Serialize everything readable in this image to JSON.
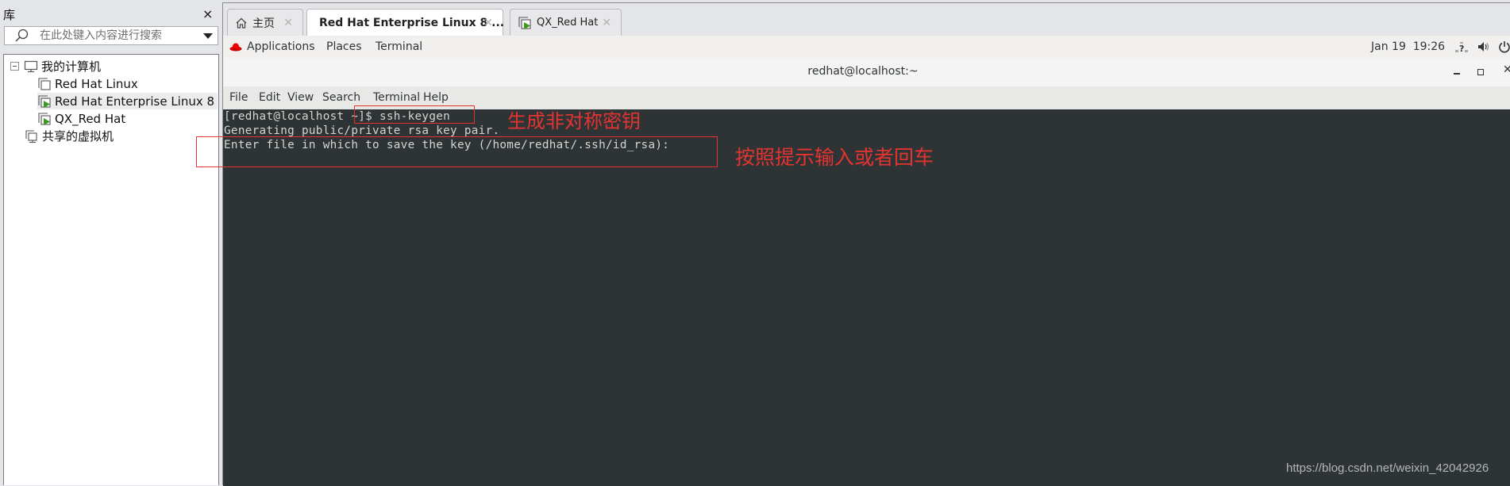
{
  "library": {
    "title": "库",
    "close_icon": "×",
    "search_placeholder": "在此处键入内容进行搜索",
    "tree": [
      {
        "label": "我的计算机",
        "icon": "computer-icon",
        "level": 0,
        "expanded": true
      },
      {
        "label": "Red Hat Linux",
        "icon": "vm-icon",
        "level": 1,
        "running": false
      },
      {
        "label": "Red Hat Enterprise Linux 8",
        "icon": "vm-running-icon",
        "level": 1,
        "running": true,
        "selected": true
      },
      {
        "label": "QX_Red Hat",
        "icon": "vm-running-icon",
        "level": 1,
        "running": true
      },
      {
        "label": "共享的虚拟机",
        "icon": "shared-vms-icon",
        "level": 0
      }
    ]
  },
  "tabs": [
    {
      "label": "主页",
      "icon": "home-icon",
      "active": false
    },
    {
      "label": "Red Hat Enterprise Linux 8 ...",
      "icon": "vm-running-icon",
      "active": true
    },
    {
      "label": "QX_Red Hat",
      "icon": "vm-running-icon",
      "active": false
    }
  ],
  "gnome_bar": {
    "applications": "Applications",
    "places": "Places",
    "terminal": "Terminal",
    "clock": "Jan 19  19:26",
    "status_icons": [
      "network-unknown-icon",
      "volume-icon",
      "power-icon"
    ]
  },
  "terminal_window": {
    "title": "redhat@localhost:~",
    "menu": [
      "File",
      "Edit",
      "View",
      "Search",
      "Terminal",
      "Help"
    ],
    "lines": [
      "[redhat@localhost ~]$ ssh-keygen",
      "Generating public/private rsa key pair.",
      "Enter file in which to save the key (/home/redhat/.ssh/id_rsa):"
    ]
  },
  "annotations": [
    {
      "text": "生成非对称密钥",
      "color": "#e5332f"
    },
    {
      "text": "按照提示输入或者回车",
      "color": "#e5332f"
    }
  ],
  "watermark": "https://blog.csdn.net/weixin_42042926",
  "colors": {
    "terminal_bg": "#2e3436",
    "terminal_fg": "#d3d7cf",
    "annotation_red": "#e5332f",
    "vm_running_green": "#3a9a22"
  }
}
